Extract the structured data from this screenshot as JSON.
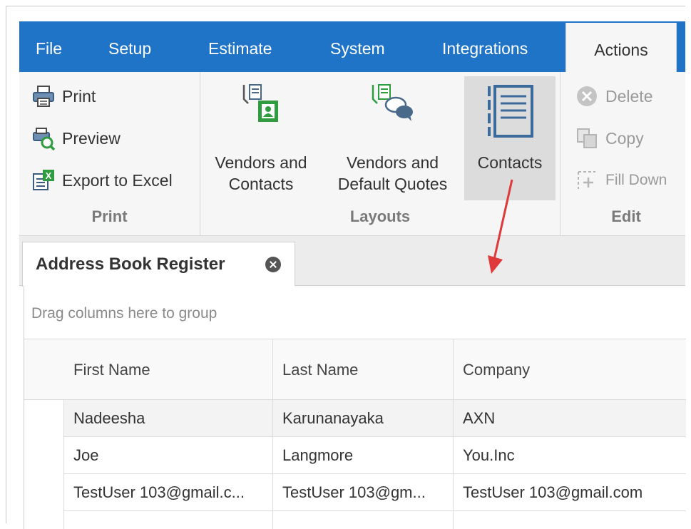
{
  "ribbon_tabs": [
    "File",
    "Setup",
    "Estimate",
    "System",
    "Integrations",
    "Actions"
  ],
  "print_group": {
    "label": "Print",
    "items": [
      "Print",
      "Preview",
      "Export to Excel"
    ]
  },
  "layouts_group": {
    "label": "Layouts",
    "vendors_contacts": [
      "Vendors and",
      "Contacts"
    ],
    "vendors_quotes": [
      "Vendors and",
      "Default Quotes"
    ],
    "contacts": "Contacts"
  },
  "edit_group": {
    "label": "Edit",
    "items": [
      "Delete",
      "Copy",
      "Fill Down"
    ]
  },
  "document_tab": {
    "title": "Address Book Register"
  },
  "grid": {
    "group_panel_text": "Drag columns here to group",
    "columns": [
      "First Name",
      "Last Name",
      "Company"
    ],
    "rows": [
      [
        "Nadeesha",
        "Karunanayaka",
        "AXN"
      ],
      [
        "Joe",
        "Langmore",
        "You.Inc"
      ],
      [
        "TestUser 103@gmail.c...",
        "TestUser 103@gm...",
        "TestUser 103@gmail.com"
      ]
    ]
  },
  "colors": {
    "ribbon_tab_bar": "#1f74c8",
    "annotation_arrow": "#e0393b"
  }
}
